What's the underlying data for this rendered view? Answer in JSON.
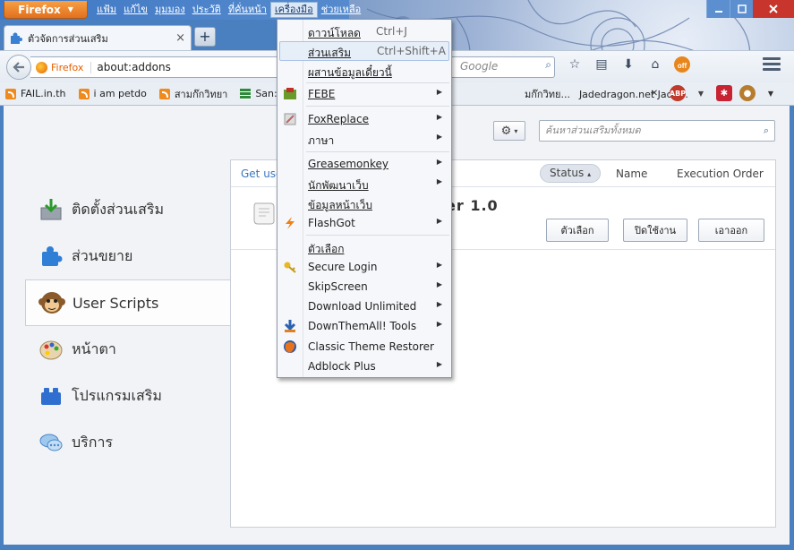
{
  "window": {
    "firefox_button": "Firefox",
    "menubar": [
      "แฟ้ม",
      "แก้ไข",
      "มุมมอง",
      "ประวัติ",
      "ที่คั่นหน้า",
      "เครื่องมือ",
      "ช่วยเหลือ"
    ],
    "active_menu": "เครื่องมือ"
  },
  "tab": {
    "title": "ตัวจัดการส่วนเสริม",
    "close": "×",
    "new_tab": "+"
  },
  "navbar": {
    "identity": "Firefox",
    "url": "about:addons",
    "search_placeholder": "Google"
  },
  "bookmarks": {
    "items": [
      "FAIL.in.th",
      "i am petdo",
      "สามก๊กวิทยา",
      "San: Th"
    ],
    "right_items": [
      "มก๊กวิทย...",
      "Jadedragon.net Jade..."
    ]
  },
  "addons": {
    "search_placeholder": "ค้นหาส่วนเสริมทั้งหมด",
    "get_link": "Get user",
    "sort": {
      "status": "Status",
      "name": "Name",
      "exec": "Execution Order"
    },
    "item_title": "er  1.0",
    "buttons": {
      "options": "ตัวเลือก",
      "disable": "ปิดใช้งาน",
      "remove": "เอาออก"
    },
    "categories": [
      {
        "label": "ติดตั้งส่วนเสริม",
        "icon": "install-icon"
      },
      {
        "label": "ส่วนขยาย",
        "icon": "puzzle-icon"
      },
      {
        "label": "User Scripts",
        "icon": "monkey-icon"
      },
      {
        "label": "หน้าตา",
        "icon": "palette-icon"
      },
      {
        "label": "โปรแกรมเสริม",
        "icon": "plugin-icon"
      },
      {
        "label": "บริการ",
        "icon": "chat-icon"
      }
    ]
  },
  "tools_menu": {
    "downloads": {
      "label": "ดาวน์โหลด",
      "key": "Ctrl+J"
    },
    "addons": {
      "label": "ส่วนเสริม",
      "key": "Ctrl+Shift+A"
    },
    "sync": {
      "label": "ผสานข้อมูลเดี๋ยวนี้"
    },
    "febe": {
      "label": "FEBE"
    },
    "foxreplace": {
      "label": "FoxReplace"
    },
    "language": {
      "label": "ภาษา"
    },
    "greasemonkey": {
      "label": "Greasemonkey"
    },
    "webdev": {
      "label": "นักพัฒนาเว็บ"
    },
    "pageinfo": {
      "label": "ข้อมูลหน้าเว็บ"
    },
    "flashgot": {
      "label": "FlashGot"
    },
    "options": {
      "label": "ตัวเลือก"
    },
    "securelogin": {
      "label": "Secure Login"
    },
    "skipscreen": {
      "label": "SkipScreen"
    },
    "downloadunlimited": {
      "label": "Download Unlimited"
    },
    "downthemall": {
      "label": "DownThemAll! Tools"
    },
    "classictheme": {
      "label": "Classic Theme Restorer"
    },
    "adblock": {
      "label": "Adblock Plus"
    }
  }
}
